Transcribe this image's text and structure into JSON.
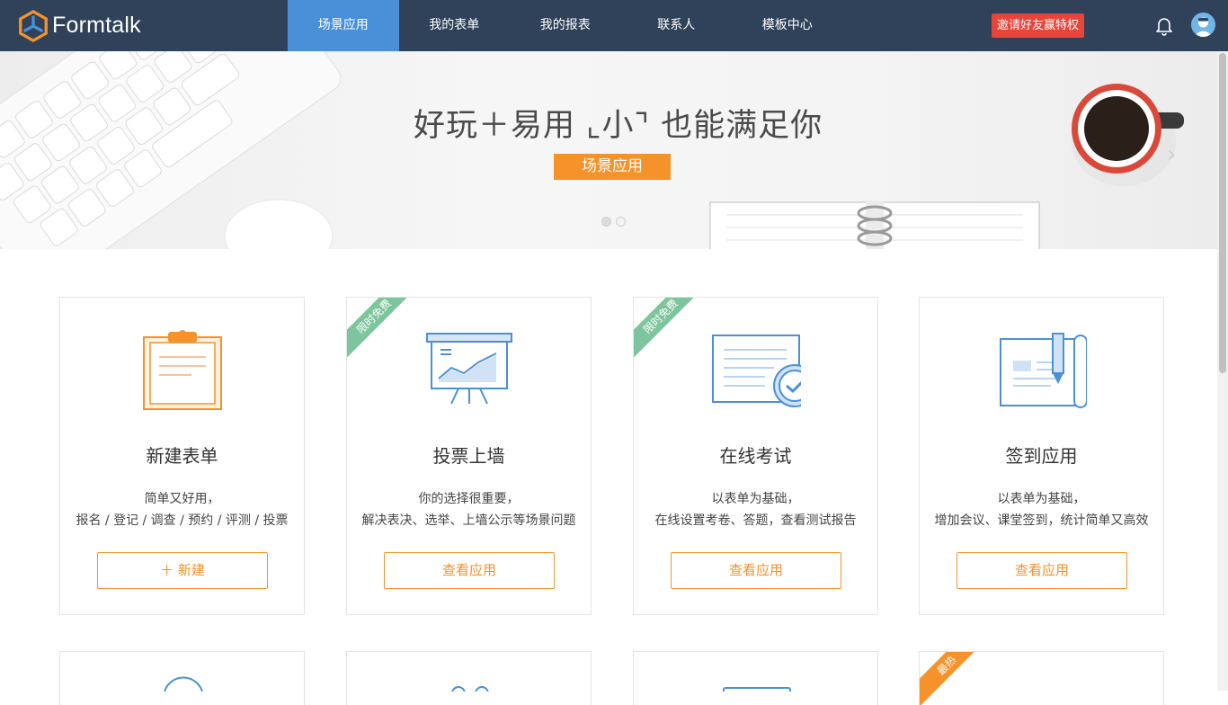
{
  "nav": {
    "logo_text": "Formtalk",
    "items": [
      {
        "label": "场景应用",
        "active": true
      },
      {
        "label": "我的表单",
        "active": false
      },
      {
        "label": "我的报表",
        "active": false
      },
      {
        "label": "联系人",
        "active": false
      },
      {
        "label": "模板中心",
        "active": false
      }
    ],
    "invite_label": "邀请好友赢特权",
    "bell_icon": "bell-icon",
    "avatar_icon": "user-avatar-icon"
  },
  "banner": {
    "title": "好玩＋易用 ⌞小⌝ 也能满足你",
    "button_label": "场景应用",
    "slide_count": 2,
    "active_slide": 1
  },
  "cards": [
    {
      "title": "新建表单",
      "desc_line1": "简单又好用，",
      "desc_line2": "报名 / 登记 / 调查 / 预约 / 评测 / 投票",
      "button_label": "＋ 新建",
      "icon": "clipboard-icon",
      "ribbon": ""
    },
    {
      "title": "投票上墙",
      "desc_line1": "你的选择很重要，",
      "desc_line2": "解决表决、选举、上墙公示等场景问题",
      "button_label": "查看应用",
      "icon": "presentation-board-icon",
      "ribbon": "限时免费"
    },
    {
      "title": "在线考试",
      "desc_line1": "以表单为基础，",
      "desc_line2": "在线设置考卷、答题，查看测试报告",
      "button_label": "查看应用",
      "icon": "exam-check-icon",
      "ribbon": "限时免费"
    },
    {
      "title": "签到应用",
      "desc_line1": "以表单为基础，",
      "desc_line2": "增加会议、课堂签到，统计简单又高效",
      "button_label": "查看应用",
      "icon": "sign-in-scroll-icon",
      "ribbon": ""
    }
  ],
  "cards_row2": [
    {
      "ribbon": ""
    },
    {
      "ribbon": ""
    },
    {
      "ribbon": ""
    },
    {
      "ribbon": "最热"
    }
  ],
  "colors": {
    "nav_bg": "#2f4259",
    "nav_active": "#4a90d9",
    "accent_orange": "#f5922a",
    "invite_red": "#e8443a",
    "ribbon_green": "#7dc59c"
  }
}
